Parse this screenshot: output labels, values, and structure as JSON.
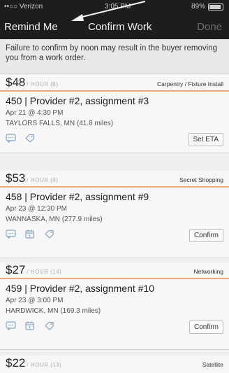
{
  "status_bar": {
    "carrier": "••○○ Verizon",
    "time": "3:05 PM",
    "battery_text": "89%",
    "battery_level": 0.89
  },
  "nav": {
    "left_label": "Remind Me",
    "title": "Confirm Work",
    "right_label": "Done"
  },
  "notice": "Failure to confirm by noon may result in the buyer removing you from a work order.",
  "colors": {
    "accent_line": "#f0a77a",
    "nav_bg": "#1d1d1f",
    "icon": "#8aa5c8"
  },
  "work_orders": [
    {
      "price": "$48",
      "unit": "/ HOUR (8)",
      "category": "Carpentry / Fixture Install",
      "title": "450 | Provider #2, assignment #3",
      "date": "Apr 21 @ 4:30 PM",
      "location": "TAYLORS FALLS, MN (41.8 miles)",
      "icons": [
        "chat-icon",
        "tag-icon"
      ],
      "action": "Set ETA"
    },
    {
      "price": "$53",
      "unit": "/ HOUR (9)",
      "category": "Secret Shopping",
      "title": "458 | Provider #2, assignment #9",
      "date": "Apr 23 @ 12:30 PM",
      "location": "WANNASKA, MN (277.9 miles)",
      "icons": [
        "chat-icon",
        "calendar-icon",
        "tag-icon"
      ],
      "action": "Confirm"
    },
    {
      "price": "$27",
      "unit": "/ HOUR (14)",
      "category": "Networking",
      "title": "459 | Provider #2, assignment #10",
      "date": "Apr 23 @ 3:00 PM",
      "location": "HARDWICK, MN (169.3 miles)",
      "icons": [
        "chat-icon",
        "calendar-icon",
        "tag-icon"
      ],
      "action": "Confirm"
    },
    {
      "price": "$22",
      "unit": "/ HOUR (13)",
      "category": "Satellite"
    }
  ]
}
